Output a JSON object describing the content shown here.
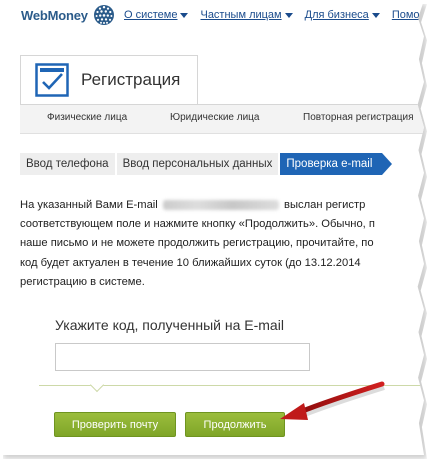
{
  "header": {
    "logo": "WebMoney",
    "nav": [
      {
        "label": "О системе"
      },
      {
        "label": "Частным лицам"
      },
      {
        "label": "Для бизнеса"
      },
      {
        "label": "Помощ"
      }
    ]
  },
  "registration": {
    "title": "Регистрация",
    "subnav": [
      "Физические лица",
      "Юридические лица",
      "Повторная регистрация"
    ]
  },
  "steps": [
    {
      "label": "Ввод телефона",
      "active": false
    },
    {
      "label": "Ввод персональных данных",
      "active": false
    },
    {
      "label": "Проверка e-mail",
      "active": true
    }
  ],
  "info": {
    "line1_before": "На указанный Вами E-mail",
    "line1_after": "выслан регистр",
    "line2": "соответствующем поле и нажмите кнопку «Продолжить». Обычно, п",
    "line3": "наше письмо и не можете продолжить регистрацию, прочитайте, по",
    "line4": "код будет актуален в течение 10 ближайших суток (до 13.12.2014",
    "line5": "регистрацию в системе."
  },
  "code": {
    "label": "Укажите код, полученный на E-mail",
    "value": ""
  },
  "buttons": {
    "check_mail": "Проверить почту",
    "continue": "Продолжить"
  },
  "colors": {
    "brand_blue": "#1f65b5",
    "button_green": "#8db032",
    "arrow_red": "#c01a1a"
  }
}
